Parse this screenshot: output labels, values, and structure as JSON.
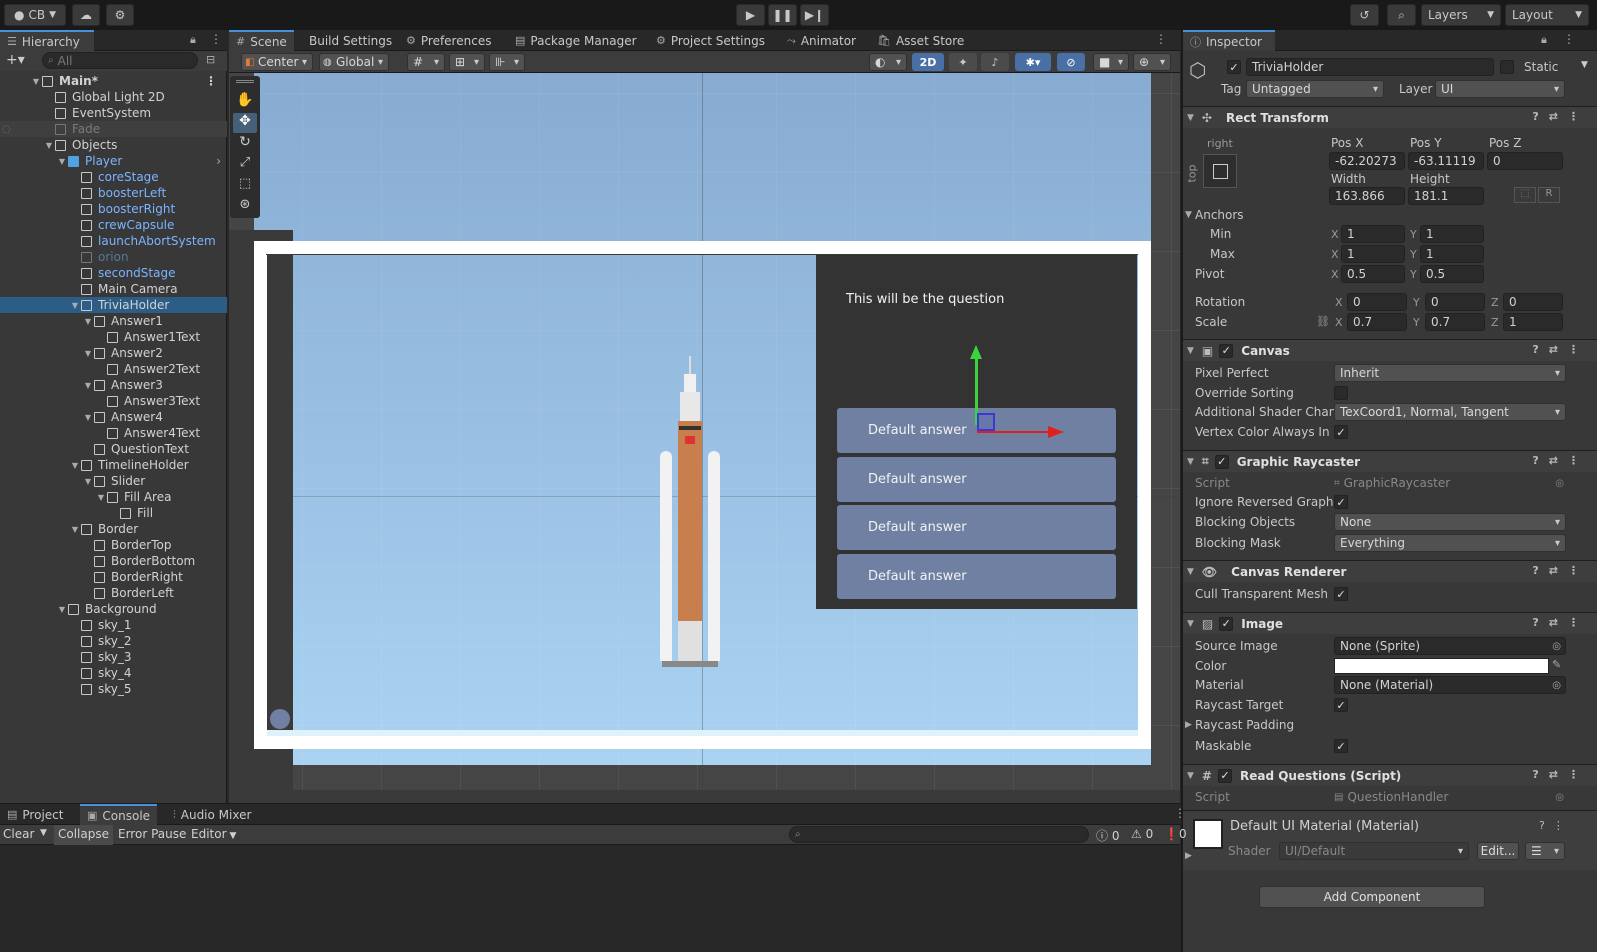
{
  "topbar": {
    "account": "CB",
    "layers": "Layers",
    "layout": "Layout"
  },
  "hierarchy": {
    "tab": "Hierarchy",
    "search_placeholder": "All",
    "items": [
      {
        "label": "Main*",
        "indent": 0,
        "arrow": "▼",
        "style": "bold"
      },
      {
        "label": "Global Light 2D",
        "indent": 1,
        "arrow": "",
        "style": ""
      },
      {
        "label": "EventSystem",
        "indent": 1,
        "arrow": "",
        "style": ""
      },
      {
        "label": "Fade",
        "indent": 1,
        "arrow": "",
        "style": "grey"
      },
      {
        "label": "Objects",
        "indent": 1,
        "arrow": "▼",
        "style": ""
      },
      {
        "label": "Player",
        "indent": 2,
        "arrow": "▼",
        "style": "blue"
      },
      {
        "label": "coreStage",
        "indent": 3,
        "arrow": "",
        "style": "blue"
      },
      {
        "label": "boosterLeft",
        "indent": 3,
        "arrow": "",
        "style": "blue"
      },
      {
        "label": "boosterRight",
        "indent": 3,
        "arrow": "",
        "style": "blue"
      },
      {
        "label": "crewCapsule",
        "indent": 3,
        "arrow": "",
        "style": "blue"
      },
      {
        "label": "launchAbortSystem",
        "indent": 3,
        "arrow": "",
        "style": "blue"
      },
      {
        "label": "orion",
        "indent": 3,
        "arrow": "",
        "style": "greyblue"
      },
      {
        "label": "secondStage",
        "indent": 3,
        "arrow": "",
        "style": "blue"
      },
      {
        "label": "Main Camera",
        "indent": 3,
        "arrow": "",
        "style": ""
      },
      {
        "label": "TriviaHolder",
        "indent": 3,
        "arrow": "▼",
        "style": "sel"
      },
      {
        "label": "Answer1",
        "indent": 4,
        "arrow": "▼",
        "style": ""
      },
      {
        "label": "Answer1Text",
        "indent": 5,
        "arrow": "",
        "style": ""
      },
      {
        "label": "Answer2",
        "indent": 4,
        "arrow": "▼",
        "style": ""
      },
      {
        "label": "Answer2Text",
        "indent": 5,
        "arrow": "",
        "style": ""
      },
      {
        "label": "Answer3",
        "indent": 4,
        "arrow": "▼",
        "style": ""
      },
      {
        "label": "Answer3Text",
        "indent": 5,
        "arrow": "",
        "style": ""
      },
      {
        "label": "Answer4",
        "indent": 4,
        "arrow": "▼",
        "style": ""
      },
      {
        "label": "Answer4Text",
        "indent": 5,
        "arrow": "",
        "style": ""
      },
      {
        "label": "QuestionText",
        "indent": 4,
        "arrow": "",
        "style": ""
      },
      {
        "label": "TimelineHolder",
        "indent": 3,
        "arrow": "▼",
        "style": ""
      },
      {
        "label": "Slider",
        "indent": 4,
        "arrow": "▼",
        "style": ""
      },
      {
        "label": "Fill Area",
        "indent": 5,
        "arrow": "▼",
        "style": ""
      },
      {
        "label": "Fill",
        "indent": 6,
        "arrow": "",
        "style": ""
      },
      {
        "label": "Border",
        "indent": 3,
        "arrow": "▼",
        "style": ""
      },
      {
        "label": "BorderTop",
        "indent": 4,
        "arrow": "",
        "style": ""
      },
      {
        "label": "BorderBottom",
        "indent": 4,
        "arrow": "",
        "style": ""
      },
      {
        "label": "BorderRight",
        "indent": 4,
        "arrow": "",
        "style": ""
      },
      {
        "label": "BorderLeft",
        "indent": 4,
        "arrow": "",
        "style": ""
      },
      {
        "label": "Background",
        "indent": 2,
        "arrow": "▼",
        "style": ""
      },
      {
        "label": "sky_1",
        "indent": 3,
        "arrow": "",
        "style": ""
      },
      {
        "label": "sky_2",
        "indent": 3,
        "arrow": "",
        "style": ""
      },
      {
        "label": "sky_3",
        "indent": 3,
        "arrow": "",
        "style": ""
      },
      {
        "label": "sky_4",
        "indent": 3,
        "arrow": "",
        "style": ""
      },
      {
        "label": "sky_5",
        "indent": 3,
        "arrow": "",
        "style": ""
      }
    ]
  },
  "scene": {
    "tabs": [
      "Scene",
      "Build Settings",
      "Preferences",
      "Package Manager",
      "Project Settings",
      "Animator",
      "Asset Store"
    ],
    "pivot": "Center",
    "space": "Global",
    "mode2d": "2D",
    "question": "This will be the question",
    "answers": [
      "Default answer",
      "Default answer",
      "Default answer",
      "Default answer"
    ]
  },
  "inspector": {
    "tab": "Inspector",
    "object_name": "TriviaHolder",
    "static_label": "Static",
    "tag_label": "Tag",
    "tag_value": "Untagged",
    "layer_label": "Layer",
    "layer_value": "UI",
    "rect_transform": {
      "title": "Rect Transform",
      "anchor_h": "right",
      "anchor_v": "top",
      "posx_label": "Pos X",
      "posy_label": "Pos Y",
      "posz_label": "Pos Z",
      "posx": "-62.20273",
      "posy": "-63.11119",
      "posz": "0",
      "width_label": "Width",
      "height_label": "Height",
      "width": "163.866",
      "height": "181.1",
      "anchors_label": "Anchors",
      "min_label": "Min",
      "max_label": "Max",
      "min_x": "1",
      "min_y": "1",
      "max_x": "1",
      "max_y": "1",
      "pivot_label": "Pivot",
      "pivot_x": "0.5",
      "pivot_y": "0.5",
      "rotation_label": "Rotation",
      "rot_x": "0",
      "rot_y": "0",
      "rot_z": "0",
      "scale_label": "Scale",
      "scale_x": "0.7",
      "scale_y": "0.7",
      "scale_z": "1"
    },
    "canvas": {
      "title": "Canvas",
      "pixel_perfect_label": "Pixel Perfect",
      "pixel_perfect": "Inherit",
      "override_sorting_label": "Override Sorting",
      "shader_channels_label": "Additional Shader Chann",
      "shader_channels": "TexCoord1, Normal, Tangent",
      "vertex_color_label": "Vertex Color Always In G"
    },
    "raycaster": {
      "title": "Graphic Raycaster",
      "script_label": "Script",
      "script": "GraphicRaycaster",
      "ignore_label": "Ignore Reversed Graphic",
      "blocking_objects_label": "Blocking Objects",
      "blocking_objects": "None",
      "blocking_mask_label": "Blocking Mask",
      "blocking_mask": "Everything"
    },
    "canvas_renderer": {
      "title": "Canvas Renderer",
      "cull_label": "Cull Transparent Mesh"
    },
    "image": {
      "title": "Image",
      "source_label": "Source Image",
      "source": "None (Sprite)",
      "color_label": "Color",
      "material_label": "Material",
      "material": "None (Material)",
      "raycast_target_label": "Raycast Target",
      "raycast_padding_label": "Raycast Padding",
      "maskable_label": "Maskable"
    },
    "read_questions": {
      "title": "Read Questions (Script)",
      "script_label": "Script",
      "script": "QuestionHandler"
    },
    "material": {
      "name": "Default UI Material (Material)",
      "shader_label": "Shader",
      "shader": "UI/Default",
      "edit": "Edit..."
    },
    "add_component": "Add Component"
  },
  "bottom": {
    "tabs": [
      "Project",
      "Console",
      "Audio Mixer"
    ],
    "clear": "Clear",
    "collapse": "Collapse",
    "error_pause": "Error Pause",
    "editor": "Editor",
    "log_count": "0",
    "warn_count": "0",
    "error_count": "0"
  }
}
